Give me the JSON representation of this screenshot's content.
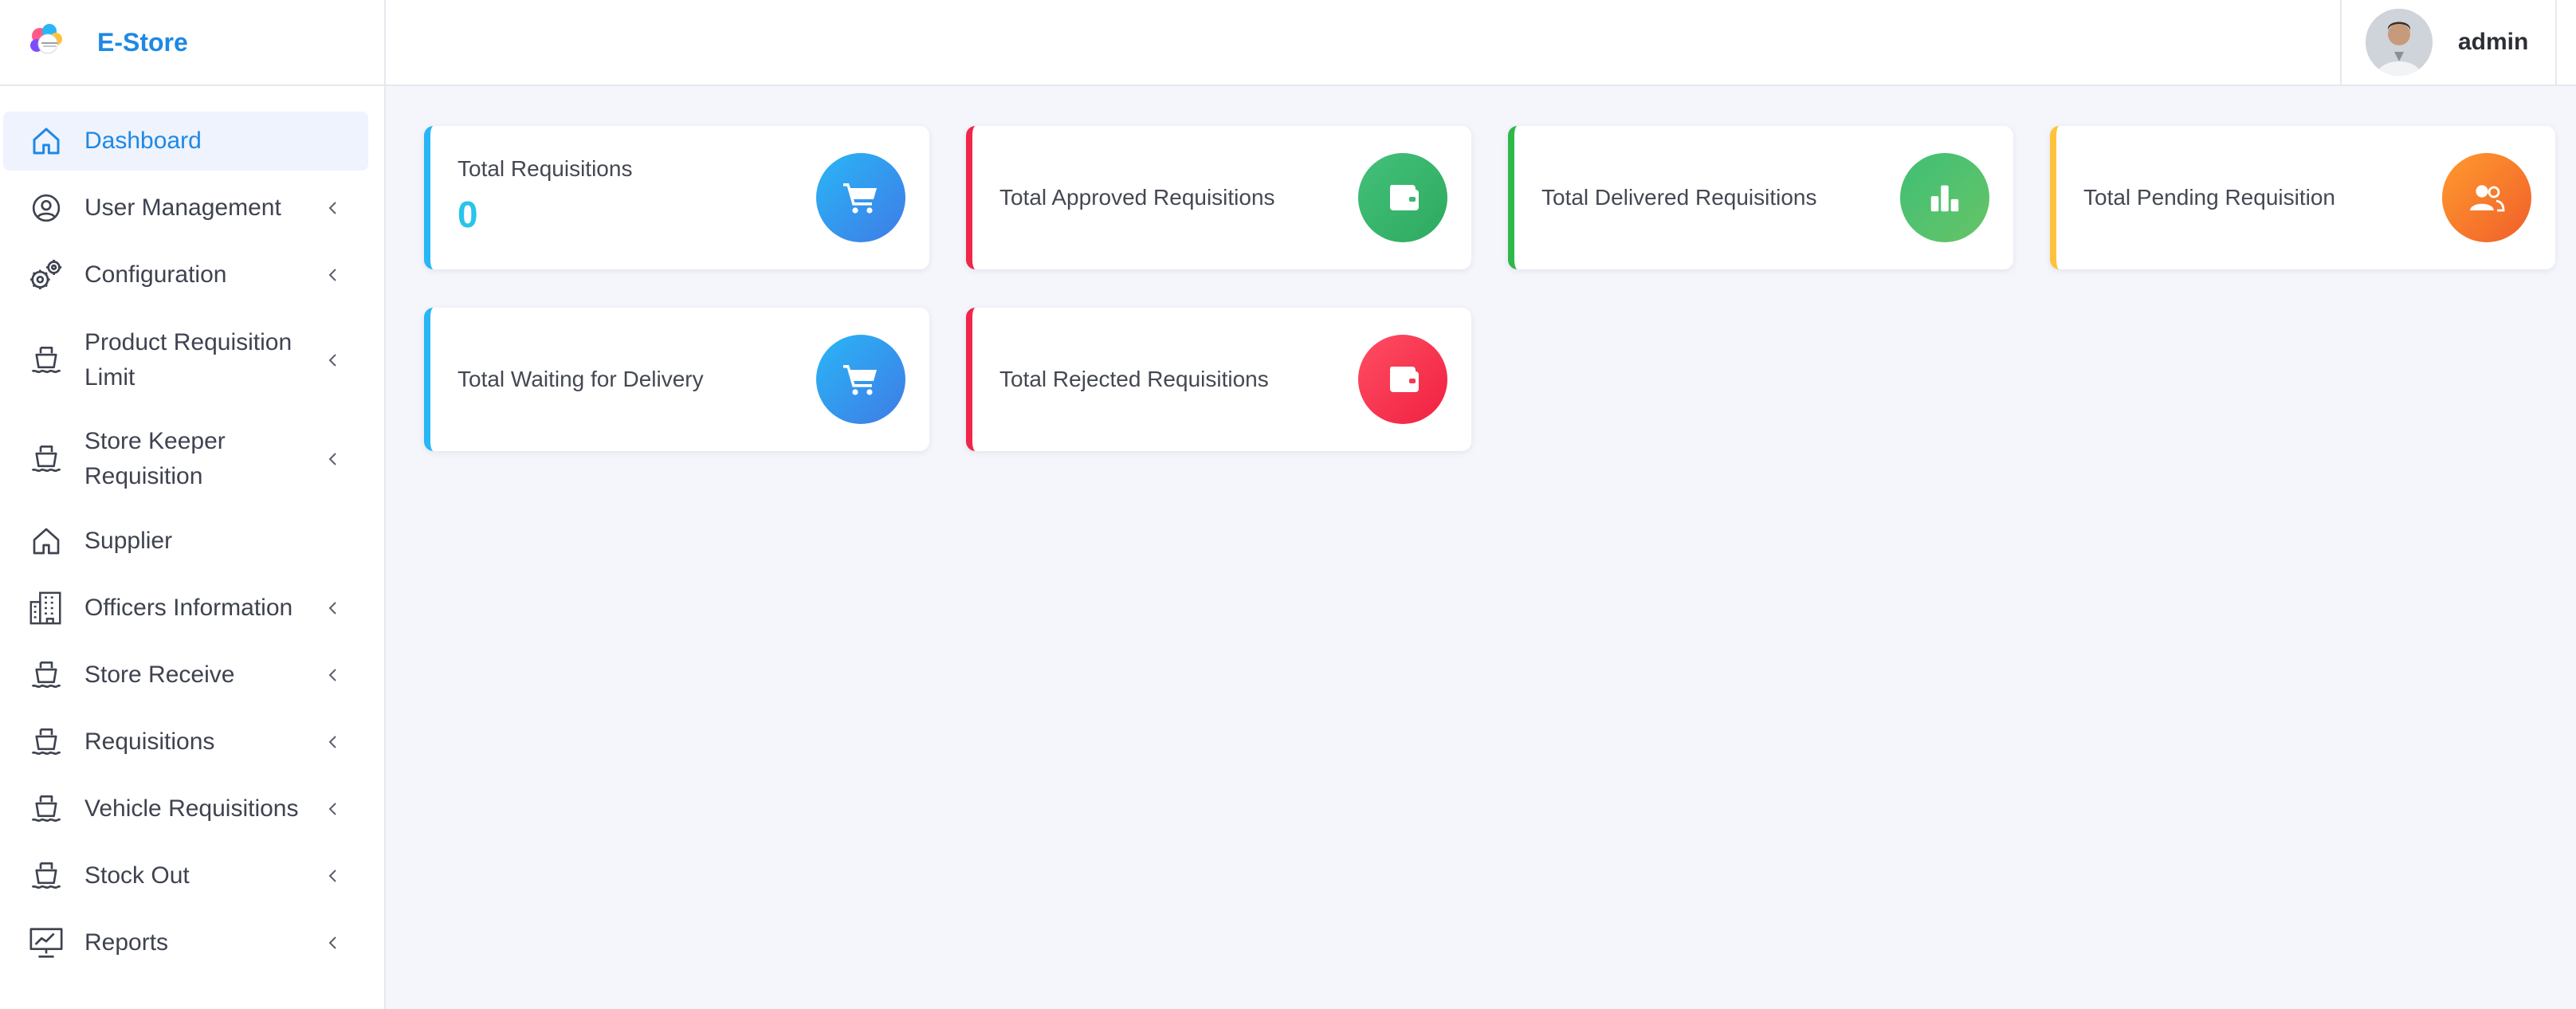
{
  "app": {
    "name": "E-Store"
  },
  "topbar": {
    "username": "admin"
  },
  "sidebar": {
    "items": [
      {
        "label": "Dashboard",
        "icon": "home-icon",
        "active": true,
        "has_submenu": false
      },
      {
        "label": "User Management",
        "icon": "user-circle-icon",
        "active": false,
        "has_submenu": true
      },
      {
        "label": "Configuration",
        "icon": "gears-icon",
        "active": false,
        "has_submenu": true
      },
      {
        "label": "Product Requisition Limit",
        "icon": "ship-icon",
        "active": false,
        "has_submenu": true
      },
      {
        "label": "Store Keeper Requisition",
        "icon": "ship-icon",
        "active": false,
        "has_submenu": true
      },
      {
        "label": "Supplier",
        "icon": "home-icon",
        "active": false,
        "has_submenu": false
      },
      {
        "label": "Officers Information",
        "icon": "building-icon",
        "active": false,
        "has_submenu": true
      },
      {
        "label": "Store Receive",
        "icon": "ship-icon",
        "active": false,
        "has_submenu": true
      },
      {
        "label": "Requisitions",
        "icon": "ship-icon",
        "active": false,
        "has_submenu": true
      },
      {
        "label": "Vehicle Requisitions",
        "icon": "ship-icon",
        "active": false,
        "has_submenu": true
      },
      {
        "label": "Stock Out",
        "icon": "ship-icon",
        "active": false,
        "has_submenu": true
      },
      {
        "label": "Reports",
        "icon": "monitor-chart-icon",
        "active": false,
        "has_submenu": true
      }
    ]
  },
  "cards": [
    {
      "title": "Total Requisitions",
      "value": "0",
      "icon": "cart-icon",
      "accent": "#29b6f6"
    },
    {
      "title": "Total Approved Requisitions",
      "icon": "wallet-icon",
      "accent": "#f0264a"
    },
    {
      "title": "Total Delivered Requisitions",
      "icon": "bar-chart-icon",
      "accent": "#2fb84a"
    },
    {
      "title": "Total Pending Requisition",
      "icon": "users-icon",
      "accent": "#ffc23d"
    },
    {
      "title": "Total Waiting for Delivery",
      "icon": "cart-icon",
      "accent": "#29b6f6"
    },
    {
      "title": "Total Rejected Requisitions",
      "icon": "wallet-icon",
      "accent": "#f0264a"
    }
  ],
  "colors": {
    "brand": "#1e88e5",
    "background": "#f5f6fc",
    "value": "#29c4e9"
  }
}
